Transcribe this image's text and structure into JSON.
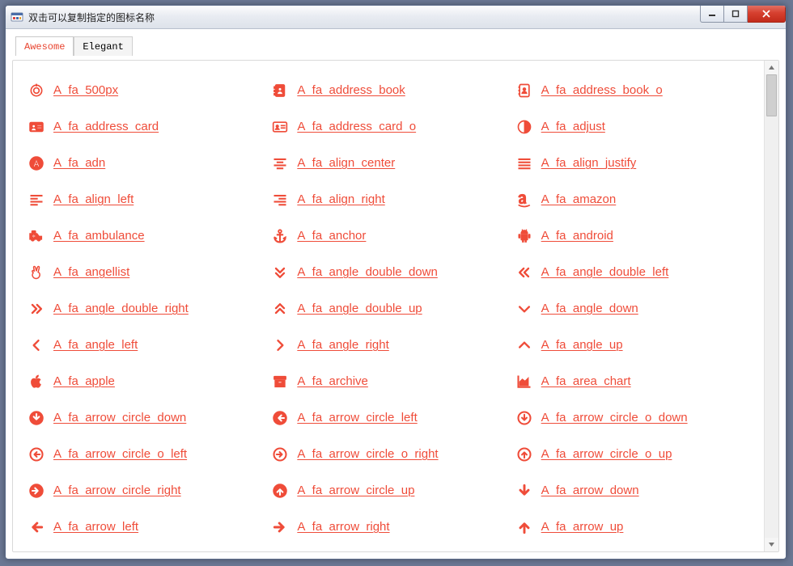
{
  "window": {
    "title": "双击可以复制指定的图标名称"
  },
  "tabs": {
    "awesome": "Awesome",
    "elegant": "Elegant",
    "activeIndex": 0
  },
  "icons": [
    {
      "name": "A_fa_500px",
      "glyph": "500px"
    },
    {
      "name": "A_fa_address_book",
      "glyph": "address-book"
    },
    {
      "name": "A_fa_address_book_o",
      "glyph": "address-book-o"
    },
    {
      "name": "A_fa_address_card",
      "glyph": "address-card"
    },
    {
      "name": "A_fa_address_card_o",
      "glyph": "address-card-o"
    },
    {
      "name": "A_fa_adjust",
      "glyph": "adjust"
    },
    {
      "name": "A_fa_adn",
      "glyph": "adn"
    },
    {
      "name": "A_fa_align_center",
      "glyph": "align-center"
    },
    {
      "name": "A_fa_align_justify",
      "glyph": "align-justify"
    },
    {
      "name": "A_fa_align_left",
      "glyph": "align-left"
    },
    {
      "name": "A_fa_align_right",
      "glyph": "align-right"
    },
    {
      "name": "A_fa_amazon",
      "glyph": "amazon"
    },
    {
      "name": "A_fa_ambulance",
      "glyph": "ambulance"
    },
    {
      "name": "A_fa_anchor",
      "glyph": "anchor"
    },
    {
      "name": "A_fa_android",
      "glyph": "android"
    },
    {
      "name": "A_fa_angellist",
      "glyph": "angellist"
    },
    {
      "name": "A_fa_angle_double_down",
      "glyph": "angle-double-down"
    },
    {
      "name": "A_fa_angle_double_left",
      "glyph": "angle-double-left"
    },
    {
      "name": "A_fa_angle_double_right",
      "glyph": "angle-double-right"
    },
    {
      "name": "A_fa_angle_double_up",
      "glyph": "angle-double-up"
    },
    {
      "name": "A_fa_angle_down",
      "glyph": "angle-down"
    },
    {
      "name": "A_fa_angle_left",
      "glyph": "angle-left"
    },
    {
      "name": "A_fa_angle_right",
      "glyph": "angle-right"
    },
    {
      "name": "A_fa_angle_up",
      "glyph": "angle-up"
    },
    {
      "name": "A_fa_apple",
      "glyph": "apple"
    },
    {
      "name": "A_fa_archive",
      "glyph": "archive"
    },
    {
      "name": "A_fa_area_chart",
      "glyph": "area-chart"
    },
    {
      "name": "A_fa_arrow_circle_down",
      "glyph": "arrow-circle-down"
    },
    {
      "name": "A_fa_arrow_circle_left",
      "glyph": "arrow-circle-left"
    },
    {
      "name": "A_fa_arrow_circle_o_down",
      "glyph": "arrow-circle-o-down"
    },
    {
      "name": "A_fa_arrow_circle_o_left",
      "glyph": "arrow-circle-o-left"
    },
    {
      "name": "A_fa_arrow_circle_o_right",
      "glyph": "arrow-circle-o-right"
    },
    {
      "name": "A_fa_arrow_circle_o_up",
      "glyph": "arrow-circle-o-up"
    },
    {
      "name": "A_fa_arrow_circle_right",
      "glyph": "arrow-circle-right"
    },
    {
      "name": "A_fa_arrow_circle_up",
      "glyph": "arrow-circle-up"
    },
    {
      "name": "A_fa_arrow_down",
      "glyph": "arrow-down"
    },
    {
      "name": "A_fa_arrow_left",
      "glyph": "arrow-left"
    },
    {
      "name": "A_fa_arrow_right",
      "glyph": "arrow-right"
    },
    {
      "name": "A_fa_arrow_up",
      "glyph": "arrow-up"
    }
  ]
}
